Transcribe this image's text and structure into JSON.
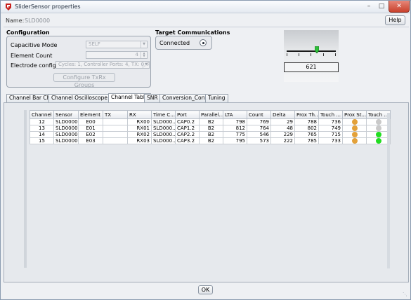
{
  "window": {
    "title": "SliderSensor properties"
  },
  "name": {
    "label": "Name:",
    "value": "SLD0000"
  },
  "help": {
    "label": "Help"
  },
  "configuration": {
    "title": "Configuration",
    "capacitive_mode": {
      "label": "Capacitive Mode",
      "value": "SELF"
    },
    "element_count": {
      "label": "Element Count",
      "value": "4"
    },
    "electrode_config": {
      "label": "Electrode config",
      "value": "Cycles: 1, Controller Ports: 4, TX: 0, RX: 4"
    },
    "txrx_button": "Configure TxRx Groups"
  },
  "target_comm": {
    "title": "Target Communications",
    "status": "Connected",
    "selected": true
  },
  "slider": {
    "value": "621",
    "position": 0.62
  },
  "tabs": [
    {
      "label": "Channel Bar Chart"
    },
    {
      "label": "Channel Oscilloscope Plot"
    },
    {
      "label": "Channel Table",
      "active": true
    },
    {
      "label": "SNR"
    },
    {
      "label": "Conversion_Control"
    },
    {
      "label": "Tuning"
    }
  ],
  "table": {
    "headers": [
      "Channel",
      "Sensor",
      "Element",
      "TX",
      "RX",
      "Time C...",
      "Port",
      "Parallel...",
      "LTA",
      "Count",
      "Delta",
      "Prox Th...",
      "Touch ...",
      "Prox St...",
      "Touch ..."
    ],
    "rows": [
      {
        "channel": "12",
        "sensor": "SLD0000",
        "element": "E00",
        "tx": "",
        "rx": "RX00",
        "time": "SLD000...",
        "port": "CAP0.2",
        "parallel": "B2",
        "lta": "798",
        "count": "769",
        "delta": "29",
        "prox_th": "788",
        "touch_th": "736",
        "prox_state": "#e3a13a",
        "touch_state": "#c9c9c9"
      },
      {
        "channel": "13",
        "sensor": "SLD0000",
        "element": "E01",
        "tx": "",
        "rx": "RX01",
        "time": "SLD000...",
        "port": "CAP1.2",
        "parallel": "B2",
        "lta": "812",
        "count": "764",
        "delta": "48",
        "prox_th": "802",
        "touch_th": "749",
        "prox_state": "#e3a13a",
        "touch_state": "#c9c9c9"
      },
      {
        "channel": "14",
        "sensor": "SLD0000",
        "element": "E02",
        "tx": "",
        "rx": "RX02",
        "time": "SLD000...",
        "port": "CAP2.2",
        "parallel": "B2",
        "lta": "775",
        "count": "546",
        "delta": "229",
        "prox_th": "765",
        "touch_th": "715",
        "prox_state": "#e3a13a",
        "touch_state": "#22dd22"
      },
      {
        "channel": "15",
        "sensor": "SLD0000",
        "element": "E03",
        "tx": "",
        "rx": "RX03",
        "time": "SLD000...",
        "port": "CAP3.2",
        "parallel": "B2",
        "lta": "795",
        "count": "573",
        "delta": "222",
        "prox_th": "785",
        "touch_th": "733",
        "prox_state": "#e3a13a",
        "touch_state": "#22dd22"
      }
    ]
  },
  "ok": {
    "label": "OK"
  },
  "colors": {
    "proximity": "#e3a13a",
    "touch_active": "#22dd22",
    "touch_inactive": "#c9c9c9"
  }
}
